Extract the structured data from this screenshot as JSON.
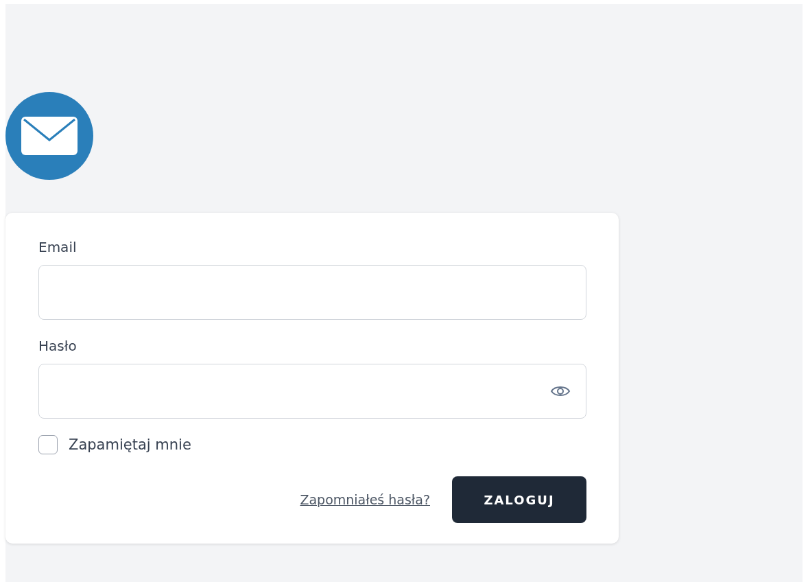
{
  "form": {
    "fields": [
      {
        "label": "Email",
        "kind": "text"
      },
      {
        "label": "Hasło",
        "kind": "password"
      }
    ],
    "remember": {
      "label": "Zapamiętaj mnie",
      "checked": false
    },
    "forgot_link": "Zapomniałeś hasła?",
    "submit": "ZALOGUJ"
  }
}
